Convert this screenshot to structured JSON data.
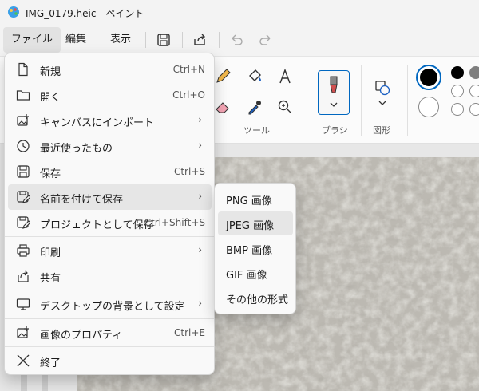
{
  "window": {
    "title": "IMG_0179.heic - ペイント"
  },
  "menubar": {
    "file": "ファイル",
    "edit": "編集",
    "view": "表示"
  },
  "ribbon": {
    "tools_label": "ツール",
    "brush_label": "ブラシ",
    "shapes_label": "図形"
  },
  "file_menu": {
    "items": [
      {
        "label": "新規",
        "shortcut": "Ctrl+N",
        "icon": "new-file-icon"
      },
      {
        "label": "開く",
        "shortcut": "Ctrl+O",
        "icon": "folder-icon"
      },
      {
        "label": "キャンバスにインポート",
        "shortcut": "",
        "icon": "import-image-icon"
      },
      {
        "label": "最近使ったもの",
        "shortcut": "",
        "icon": "clock-icon"
      },
      {
        "label": "保存",
        "shortcut": "Ctrl+S",
        "icon": "save-icon"
      },
      {
        "label": "名前を付けて保存",
        "shortcut": "",
        "icon": "save-as-icon"
      },
      {
        "label": "プロジェクトとして保存",
        "shortcut": "Ctrl+Shift+S",
        "icon": "save-project-icon"
      },
      {
        "label": "印刷",
        "shortcut": "",
        "icon": "print-icon"
      },
      {
        "label": "共有",
        "shortcut": "",
        "icon": "share-icon"
      },
      {
        "label": "デスクトップの背景として設定",
        "shortcut": "",
        "icon": "desktop-icon"
      },
      {
        "label": "画像のプロパティ",
        "shortcut": "Ctrl+E",
        "icon": "image-properties-icon"
      },
      {
        "label": "終了",
        "shortcut": "",
        "icon": "close-icon"
      }
    ],
    "arrow": "›"
  },
  "save_as_menu": {
    "items": [
      {
        "label": "PNG 画像"
      },
      {
        "label": "JPEG 画像"
      },
      {
        "label": "BMP 画像"
      },
      {
        "label": "GIF 画像"
      },
      {
        "label": "その他の形式"
      }
    ]
  },
  "colors": {
    "accent": "#0067c0",
    "swatch_black": "#000000",
    "swatch_white": "#ffffff"
  }
}
